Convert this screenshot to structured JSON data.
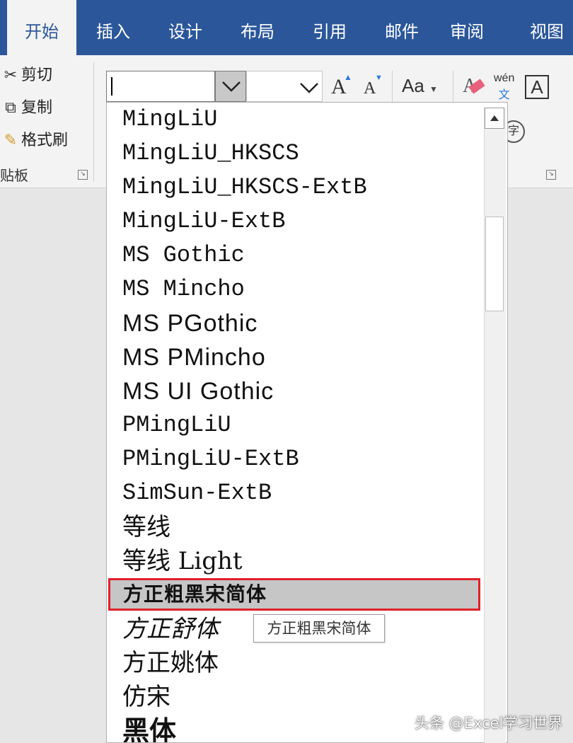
{
  "tabs": [
    "开始",
    "插入",
    "设计",
    "布局",
    "引用",
    "邮件",
    "审阅",
    "视图"
  ],
  "clipboard": {
    "cut": "剪切",
    "copy": "复制",
    "format_painter": "格式刷",
    "group_label": "粘贴板"
  },
  "font_name_value": "",
  "font_size_value": "",
  "font_list": [
    "MingLiU",
    "MingLiU_HKSCS",
    "MingLiU_HKSCS-ExtB",
    "MingLiU-ExtB",
    "MS Gothic",
    "MS Mincho",
    "MS PGothic",
    "MS PMincho",
    "MS UI Gothic",
    "PMingLiU",
    "PMingLiU-ExtB",
    "SimSun-ExtB",
    "等线",
    "等线 Light",
    "方正粗黑宋简体",
    "方正舒体",
    "方正姚体",
    "仿宋",
    "黑体"
  ],
  "selected_font": "方正粗黑宋简体",
  "tooltip": "方正粗黑宋简体",
  "ribbon_icons": {
    "grow_font": "A",
    "shrink_font": "A",
    "change_case": "Aa",
    "phonetic_guide_top": "wén",
    "phonetic_guide_bottom": "文",
    "char_border": "A",
    "enclose_char": "字"
  },
  "watermark": "头条 @Excel学习世界",
  "colors": {
    "accent": "#2b579a",
    "highlight_border": "#e0202a"
  }
}
